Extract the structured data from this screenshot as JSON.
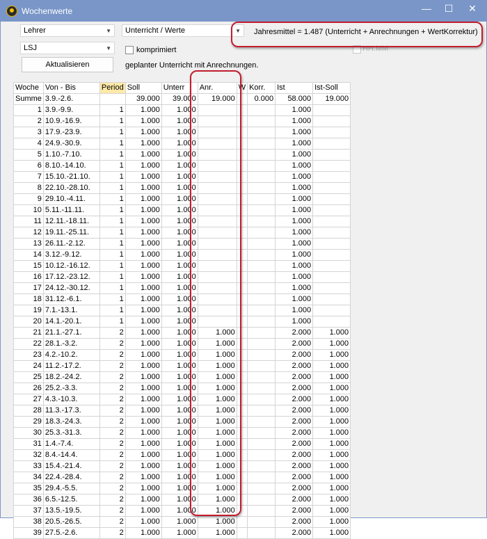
{
  "window": {
    "title": "Wochenwerte",
    "minimize_glyph": "—",
    "maximize_glyph": "☐",
    "close_glyph": "✕"
  },
  "form": {
    "teacher_select": "Lehrer",
    "view_select": "Unterricht / Werte",
    "period_select": "LSJ",
    "compress_label": "komprimiert",
    "refresh_button": "Aktualisieren",
    "planned_label": "geplanter Unterricht mit Anrechnungen.",
    "hhmm_label": "HH:MM",
    "annual_average": "Jahresmittel = 1.487 (Unterricht + Anrechnungen + WertKorrektur)"
  },
  "table": {
    "headers": [
      "Woche",
      "Von - Bis",
      "Period",
      "Soll",
      "Unterr",
      "Anr.",
      "W",
      "Korr.",
      "Ist",
      "Ist-Soll"
    ],
    "summary": [
      "Summe",
      "3.9.-2.6.",
      "",
      "39.000",
      "39.000",
      "19.000",
      "",
      "0.000",
      "58.000",
      "19.000"
    ],
    "rows": [
      [
        "1",
        "3.9.-9.9.",
        "1",
        "1.000",
        "1.000",
        "",
        "",
        "",
        "1.000",
        ""
      ],
      [
        "2",
        "10.9.-16.9.",
        "1",
        "1.000",
        "1.000",
        "",
        "",
        "",
        "1.000",
        ""
      ],
      [
        "3",
        "17.9.-23.9.",
        "1",
        "1.000",
        "1.000",
        "",
        "",
        "",
        "1.000",
        ""
      ],
      [
        "4",
        "24.9.-30.9.",
        "1",
        "1.000",
        "1.000",
        "",
        "",
        "",
        "1.000",
        ""
      ],
      [
        "5",
        "1.10.-7.10.",
        "1",
        "1.000",
        "1.000",
        "",
        "",
        "",
        "1.000",
        ""
      ],
      [
        "6",
        "8.10.-14.10.",
        "1",
        "1.000",
        "1.000",
        "",
        "",
        "",
        "1.000",
        ""
      ],
      [
        "7",
        "15.10.-21.10.",
        "1",
        "1.000",
        "1.000",
        "",
        "",
        "",
        "1.000",
        ""
      ],
      [
        "8",
        "22.10.-28.10.",
        "1",
        "1.000",
        "1.000",
        "",
        "",
        "",
        "1.000",
        ""
      ],
      [
        "9",
        "29.10.-4.11.",
        "1",
        "1.000",
        "1.000",
        "",
        "",
        "",
        "1.000",
        ""
      ],
      [
        "10",
        "5.11.-11.11.",
        "1",
        "1.000",
        "1.000",
        "",
        "",
        "",
        "1.000",
        ""
      ],
      [
        "11",
        "12.11.-18.11.",
        "1",
        "1.000",
        "1.000",
        "",
        "",
        "",
        "1.000",
        ""
      ],
      [
        "12",
        "19.11.-25.11.",
        "1",
        "1.000",
        "1.000",
        "",
        "",
        "",
        "1.000",
        ""
      ],
      [
        "13",
        "26.11.-2.12.",
        "1",
        "1.000",
        "1.000",
        "",
        "",
        "",
        "1.000",
        ""
      ],
      [
        "14",
        "3.12.-9.12.",
        "1",
        "1.000",
        "1.000",
        "",
        "",
        "",
        "1.000",
        ""
      ],
      [
        "15",
        "10.12.-16.12.",
        "1",
        "1.000",
        "1.000",
        "",
        "",
        "",
        "1.000",
        ""
      ],
      [
        "16",
        "17.12.-23.12.",
        "1",
        "1.000",
        "1.000",
        "",
        "",
        "",
        "1.000",
        ""
      ],
      [
        "17",
        "24.12.-30.12.",
        "1",
        "1.000",
        "1.000",
        "",
        "",
        "",
        "1.000",
        ""
      ],
      [
        "18",
        "31.12.-6.1.",
        "1",
        "1.000",
        "1.000",
        "",
        "",
        "",
        "1.000",
        ""
      ],
      [
        "19",
        "7.1.-13.1.",
        "1",
        "1.000",
        "1.000",
        "",
        "",
        "",
        "1.000",
        ""
      ],
      [
        "20",
        "14.1.-20.1.",
        "1",
        "1.000",
        "1.000",
        "",
        "",
        "",
        "1.000",
        ""
      ],
      [
        "21",
        "21.1.-27.1.",
        "2",
        "1.000",
        "1.000",
        "1.000",
        "",
        "",
        "2.000",
        "1.000"
      ],
      [
        "22",
        "28.1.-3.2.",
        "2",
        "1.000",
        "1.000",
        "1.000",
        "",
        "",
        "2.000",
        "1.000"
      ],
      [
        "23",
        "4.2.-10.2.",
        "2",
        "1.000",
        "1.000",
        "1.000",
        "",
        "",
        "2.000",
        "1.000"
      ],
      [
        "24",
        "11.2.-17.2.",
        "2",
        "1.000",
        "1.000",
        "1.000",
        "",
        "",
        "2.000",
        "1.000"
      ],
      [
        "25",
        "18.2.-24.2.",
        "2",
        "1.000",
        "1.000",
        "1.000",
        "",
        "",
        "2.000",
        "1.000"
      ],
      [
        "26",
        "25.2.-3.3.",
        "2",
        "1.000",
        "1.000",
        "1.000",
        "",
        "",
        "2.000",
        "1.000"
      ],
      [
        "27",
        "4.3.-10.3.",
        "2",
        "1.000",
        "1.000",
        "1.000",
        "",
        "",
        "2.000",
        "1.000"
      ],
      [
        "28",
        "11.3.-17.3.",
        "2",
        "1.000",
        "1.000",
        "1.000",
        "",
        "",
        "2.000",
        "1.000"
      ],
      [
        "29",
        "18.3.-24.3.",
        "2",
        "1.000",
        "1.000",
        "1.000",
        "",
        "",
        "2.000",
        "1.000"
      ],
      [
        "30",
        "25.3.-31.3.",
        "2",
        "1.000",
        "1.000",
        "1.000",
        "",
        "",
        "2.000",
        "1.000"
      ],
      [
        "31",
        "1.4.-7.4.",
        "2",
        "1.000",
        "1.000",
        "1.000",
        "",
        "",
        "2.000",
        "1.000"
      ],
      [
        "32",
        "8.4.-14.4.",
        "2",
        "1.000",
        "1.000",
        "1.000",
        "",
        "",
        "2.000",
        "1.000"
      ],
      [
        "33",
        "15.4.-21.4.",
        "2",
        "1.000",
        "1.000",
        "1.000",
        "",
        "",
        "2.000",
        "1.000"
      ],
      [
        "34",
        "22.4.-28.4.",
        "2",
        "1.000",
        "1.000",
        "1.000",
        "",
        "",
        "2.000",
        "1.000"
      ],
      [
        "35",
        "29.4.-5.5.",
        "2",
        "1.000",
        "1.000",
        "1.000",
        "",
        "",
        "2.000",
        "1.000"
      ],
      [
        "36",
        "6.5.-12.5.",
        "2",
        "1.000",
        "1.000",
        "1.000",
        "",
        "",
        "2.000",
        "1.000"
      ],
      [
        "37",
        "13.5.-19.5.",
        "2",
        "1.000",
        "1.000",
        "1.000",
        "",
        "",
        "2.000",
        "1.000"
      ],
      [
        "38",
        "20.5.-26.5.",
        "2",
        "1.000",
        "1.000",
        "1.000",
        "",
        "",
        "2.000",
        "1.000"
      ],
      [
        "39",
        "27.5.-2.6.",
        "2",
        "1.000",
        "1.000",
        "1.000",
        "",
        "",
        "2.000",
        "1.000"
      ]
    ]
  },
  "colors": {
    "titlebar": "#7a96c8",
    "highlight": "#c21d2e",
    "period_header": "#ffe9a8"
  }
}
